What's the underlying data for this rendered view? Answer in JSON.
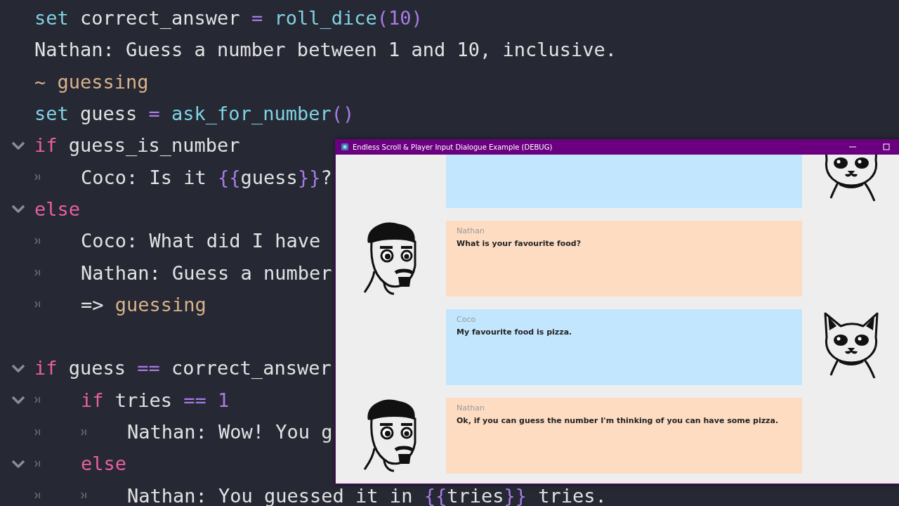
{
  "code": {
    "lines": [
      {
        "tokens": [
          {
            "t": "set",
            "kind": "fn"
          },
          {
            "t": " correct_answer ",
            "kind": "plain"
          },
          {
            "t": "= ",
            "kind": "op"
          },
          {
            "t": "roll_dice",
            "kind": "fn"
          },
          {
            "t": "(",
            "kind": "op"
          },
          {
            "t": "10",
            "kind": "op"
          },
          {
            "t": ")",
            "kind": "op"
          }
        ]
      },
      {
        "tokens": [
          {
            "t": "Nathan: Guess a number between 1 and 10, inclusive.",
            "kind": "plain"
          }
        ]
      },
      {
        "tokens": [
          {
            "t": "~ ",
            "kind": "label"
          },
          {
            "t": "guessing",
            "kind": "label"
          }
        ]
      },
      {
        "tokens": [
          {
            "t": "set",
            "kind": "fn"
          },
          {
            "t": " guess ",
            "kind": "plain"
          },
          {
            "t": "= ",
            "kind": "op"
          },
          {
            "t": "ask_for_number",
            "kind": "fn"
          },
          {
            "t": "()",
            "kind": "op"
          }
        ]
      },
      {
        "tokens": [
          {
            "t": "if",
            "kind": "kw"
          },
          {
            "t": " guess_is_number",
            "kind": "plain"
          }
        ],
        "expanded": true,
        "children": [
          {
            "tokens": [
              {
                "t": "Coco: Is it ",
                "kind": "plain"
              },
              {
                "t": "{{",
                "kind": "op"
              },
              {
                "t": "guess",
                "kind": "plain"
              },
              {
                "t": "}}",
                "kind": "op"
              },
              {
                "t": "?",
                "kind": "plain"
              }
            ]
          }
        ]
      },
      {
        "tokens": [
          {
            "t": "else",
            "kind": "kw"
          }
        ],
        "expanded": true,
        "children": [
          {
            "tokens": [
              {
                "t": "Coco: What did I have",
                "kind": "plain"
              }
            ]
          },
          {
            "tokens": [
              {
                "t": "Nathan: Guess a number",
                "kind": "plain"
              }
            ]
          },
          {
            "tokens": [
              {
                "t": "=> ",
                "kind": "plain"
              },
              {
                "t": "guessing",
                "kind": "label"
              }
            ]
          }
        ]
      },
      {
        "gap_before": true,
        "tokens": [
          {
            "t": "if",
            "kind": "kw"
          },
          {
            "t": " guess ",
            "kind": "plain"
          },
          {
            "t": "==",
            "kind": "op"
          },
          {
            "t": " correct_answer",
            "kind": "plain"
          }
        ],
        "expanded": true,
        "children": [
          {
            "tokens": [
              {
                "t": "if",
                "kind": "kw"
              },
              {
                "t": " tries ",
                "kind": "plain"
              },
              {
                "t": "== 1",
                "kind": "op"
              }
            ],
            "expanded": true,
            "children": [
              {
                "tokens": [
                  {
                    "t": "Nathan: Wow! You g",
                    "kind": "plain"
                  }
                ]
              }
            ]
          },
          {
            "tokens": [
              {
                "t": "else",
                "kind": "kw"
              }
            ],
            "expanded": true,
            "children": [
              {
                "tokens": [
                  {
                    "t": "Nathan: You guessed it in ",
                    "kind": "plain"
                  },
                  {
                    "t": "{{",
                    "kind": "op"
                  },
                  {
                    "t": "tries",
                    "kind": "plain"
                  },
                  {
                    "t": "}}",
                    "kind": "op"
                  },
                  {
                    "t": " tries.",
                    "kind": "plain"
                  }
                ]
              }
            ]
          }
        ]
      }
    ]
  },
  "window": {
    "title": "Endless Scroll & Player Input Dialogue Example (DEBUG)",
    "messages": [
      {
        "kind": "right"
      },
      {
        "kind": "left",
        "name": "Nathan",
        "text": "What is your favourite food?"
      },
      {
        "kind": "right",
        "name": "Coco",
        "text": "My favourite food is pizza."
      },
      {
        "kind": "left",
        "name": "Nathan",
        "text": "Ok, if you can guess the number I'm thinking of you can have some pizza."
      }
    ]
  }
}
